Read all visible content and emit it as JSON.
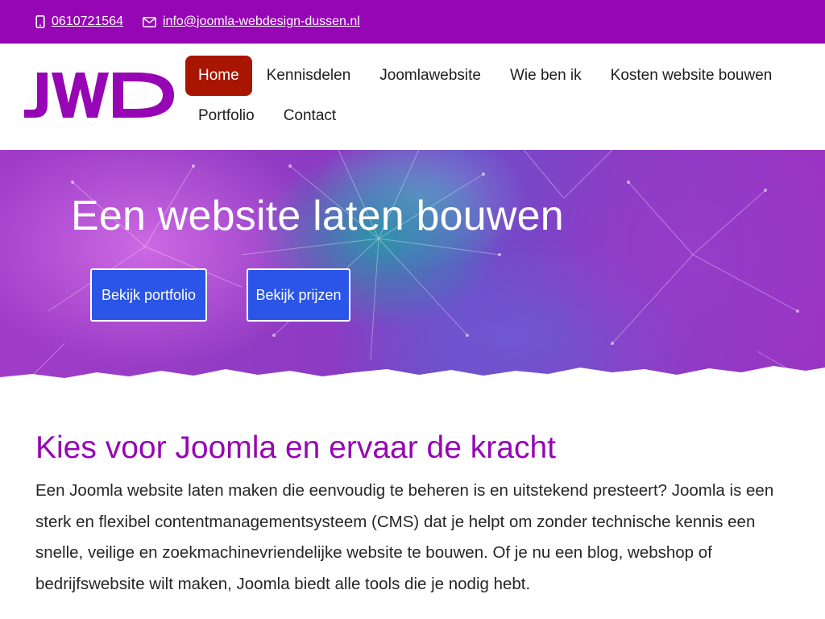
{
  "topbar": {
    "phone": "0610721564",
    "email": "info@joomla-webdesign-dussen.nl",
    "phone_icon": "mobile-phone-icon",
    "email_icon": "envelope-icon"
  },
  "logo": {
    "text": "JWD",
    "color": "#9606b4"
  },
  "nav": {
    "row1": [
      "Home",
      "Kennisdelen",
      "Joomlawebsite",
      "Wie ben ik",
      "Kosten website bouwen"
    ],
    "row2": [
      "Portfolio",
      "Contact"
    ],
    "active": "Home"
  },
  "hero": {
    "title": "Een website laten bouwen",
    "buttons": {
      "portfolio": "Bekijk portfolio",
      "prijzen": "Bekijk prijzen"
    }
  },
  "main": {
    "heading": "Kies voor Joomla en ervaar de kracht",
    "paragraph": "Een Joomla website laten maken die eenvoudig te beheren is en uitstekend presteert? Joomla is een sterk en flexibel contentmanagementsysteem (CMS) dat je helpt om zonder technische kennis een snelle, veilige en zoekmachinevriendelijke website te bouwen. Of je nu een blog, webshop of bedrijfswebsite wilt maken, Joomla biedt alle tools die je nodig hebt."
  },
  "colors": {
    "brand": "#9606b4",
    "active_nav": "#a81500",
    "button": "#2b55e6"
  }
}
